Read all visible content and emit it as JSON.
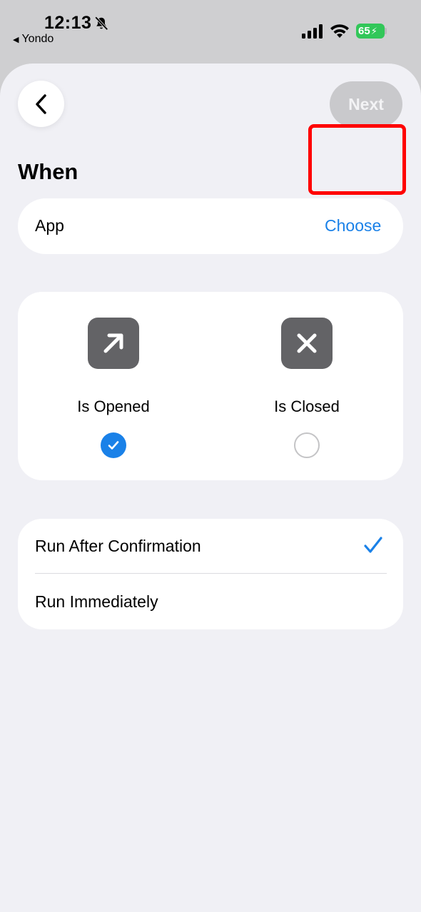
{
  "status_bar": {
    "time": "12:13",
    "back_app": "Yondo",
    "battery": "65",
    "icons": [
      "bell-slash-icon",
      "signal-icon",
      "wifi-icon",
      "battery-icon"
    ]
  },
  "header": {
    "back_icon": "chevron-left-icon",
    "next_label": "Next"
  },
  "when": {
    "title": "When",
    "app_label": "App",
    "choose_label": "Choose"
  },
  "trigger": {
    "options": [
      {
        "label": "Is Opened",
        "icon": "arrow-up-right-icon",
        "selected": true
      },
      {
        "label": "Is Closed",
        "icon": "xmark-icon",
        "selected": false
      }
    ]
  },
  "run": {
    "items": [
      {
        "label": "Run After Confirmation",
        "selected": true
      },
      {
        "label": "Run Immediately",
        "selected": false
      }
    ]
  },
  "colors": {
    "accent": "#1a81e8",
    "highlight": "#ff0000",
    "background": "#f0f0f5",
    "tile": "#636366"
  }
}
